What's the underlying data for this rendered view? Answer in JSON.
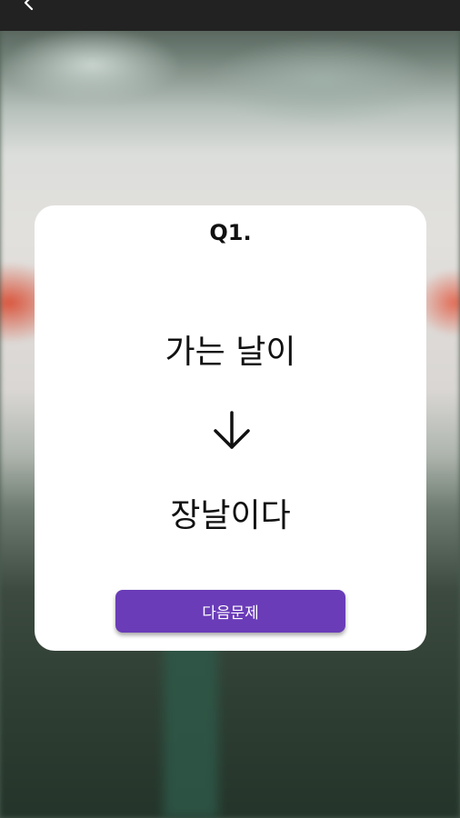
{
  "status_bar": {
    "back_icon": "chevron-left-icon"
  },
  "quiz": {
    "question_number": "Q1.",
    "phrase": "가는 날이",
    "arrow_icon": "arrow-down-icon",
    "answer": "장날이다",
    "next_button_label": "다음문제"
  },
  "colors": {
    "button": "#6a3cb8",
    "card": "#ffffff",
    "status_bar": "#222222"
  }
}
